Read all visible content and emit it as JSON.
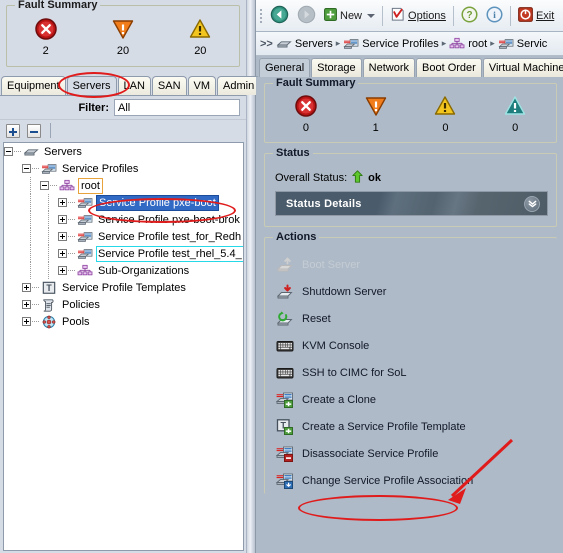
{
  "left": {
    "fault_summary": {
      "title": "Fault Summary",
      "items": [
        {
          "icon": "critical-fault-icon",
          "count": "2"
        },
        {
          "icon": "major-fault-icon",
          "count": "20"
        },
        {
          "icon": "minor-fault-icon",
          "count": "20"
        }
      ]
    },
    "tabs": [
      {
        "label": "Equipment",
        "active": false
      },
      {
        "label": "Servers",
        "active": true
      },
      {
        "label": "LAN",
        "active": false
      },
      {
        "label": "SAN",
        "active": false
      },
      {
        "label": "VM",
        "active": false
      },
      {
        "label": "Admin",
        "active": false
      }
    ],
    "filter": {
      "label": "Filter:",
      "value": "All"
    },
    "toolbar": {
      "expand_all": "expand-all-button",
      "collapse_all": "collapse-all-button"
    },
    "tree": [
      {
        "label": "Servers",
        "depth": 0,
        "expander": "minus",
        "icon": "server-icon",
        "state": "normal"
      },
      {
        "label": "Service Profiles",
        "depth": 1,
        "expander": "minus",
        "icon": "service-profile-icon",
        "state": "normal"
      },
      {
        "label": "root",
        "depth": 2,
        "expander": "minus",
        "icon": "org-icon",
        "state": "orangebox"
      },
      {
        "label": "Service Profile pxe-boot",
        "depth": 3,
        "expander": "plus",
        "icon": "service-profile-icon",
        "state": "selected"
      },
      {
        "label": "Service Profile pxe-boot-brok",
        "depth": 3,
        "expander": "plus",
        "icon": "service-profile-icon",
        "state": "normal"
      },
      {
        "label": "Service Profile test_for_Redh",
        "depth": 3,
        "expander": "plus",
        "icon": "service-profile-icon",
        "state": "normal"
      },
      {
        "label": "Service Profile test_rhel_5.4_",
        "depth": 3,
        "expander": "plus",
        "icon": "service-profile-icon",
        "state": "focusring"
      },
      {
        "label": "Sub-Organizations",
        "depth": 3,
        "expander": "plus",
        "icon": "org-icon",
        "state": "normal"
      },
      {
        "label": "Service Profile Templates",
        "depth": 1,
        "expander": "plus",
        "icon": "template-icon",
        "state": "normal"
      },
      {
        "label": "Policies",
        "depth": 1,
        "expander": "plus",
        "icon": "policies-icon",
        "state": "normal"
      },
      {
        "label": "Pools",
        "depth": 1,
        "expander": "plus",
        "icon": "pools-icon",
        "state": "normal"
      }
    ]
  },
  "right": {
    "toolbar": {
      "back": "back-arrow-icon",
      "forward": "forward-arrow-icon",
      "new_label": "New",
      "options_label": "Options",
      "help": "help-icon",
      "info": "info-icon",
      "exit_label": "Exit"
    },
    "breadcrumb": {
      "prefix": ">>",
      "segments": [
        {
          "label": "Servers",
          "icon": "server-icon"
        },
        {
          "label": "Service Profiles",
          "icon": "service-profile-icon"
        },
        {
          "label": "root",
          "icon": "org-icon"
        },
        {
          "label": "Servic",
          "icon": "service-profile-icon"
        }
      ]
    },
    "tabs": [
      {
        "label": "General",
        "active": true
      },
      {
        "label": "Storage",
        "active": false
      },
      {
        "label": "Network",
        "active": false
      },
      {
        "label": "Boot Order",
        "active": false
      },
      {
        "label": "Virtual Machines",
        "active": false
      }
    ],
    "fault_summary": {
      "title": "Fault Summary",
      "items": [
        {
          "icon": "critical-fault-icon",
          "count": "0"
        },
        {
          "icon": "major-fault-icon",
          "count": "1"
        },
        {
          "icon": "minor-fault-icon",
          "count": "0"
        },
        {
          "icon": "warning-fault-icon",
          "count": "0"
        }
      ]
    },
    "status": {
      "title": "Status",
      "overall_label": "Overall Status:",
      "overall_value": "ok",
      "details_label": "Status Details"
    },
    "actions": {
      "title": "Actions",
      "items": [
        {
          "label": "Boot Server",
          "icon": "boot-server-icon",
          "disabled": true
        },
        {
          "label": "Shutdown Server",
          "icon": "shutdown-server-icon",
          "disabled": false
        },
        {
          "label": "Reset",
          "icon": "reset-icon",
          "disabled": false
        },
        {
          "label": "KVM Console",
          "icon": "kvm-console-icon",
          "disabled": false
        },
        {
          "label": "SSH to CIMC for SoL",
          "icon": "ssh-cimc-icon",
          "disabled": false
        },
        {
          "label": "Create a Clone",
          "icon": "create-clone-icon",
          "disabled": false
        },
        {
          "label": "Create a Service Profile Template",
          "icon": "create-template-icon",
          "disabled": false
        },
        {
          "label": "Disassociate Service Profile",
          "icon": "disassociate-icon",
          "disabled": false
        },
        {
          "label": "Change Service Profile Association",
          "icon": "change-association-icon",
          "disabled": false
        }
      ]
    }
  },
  "annotations": {
    "color": "#e01b1b",
    "marks": [
      {
        "name": "servers-tab-ellipse",
        "shape": "ellipse"
      },
      {
        "name": "selected-profile-ellipse",
        "shape": "ellipse"
      },
      {
        "name": "disassociate-action-ellipse",
        "shape": "ellipse"
      },
      {
        "name": "disassociate-arrow",
        "shape": "arrow"
      }
    ]
  }
}
